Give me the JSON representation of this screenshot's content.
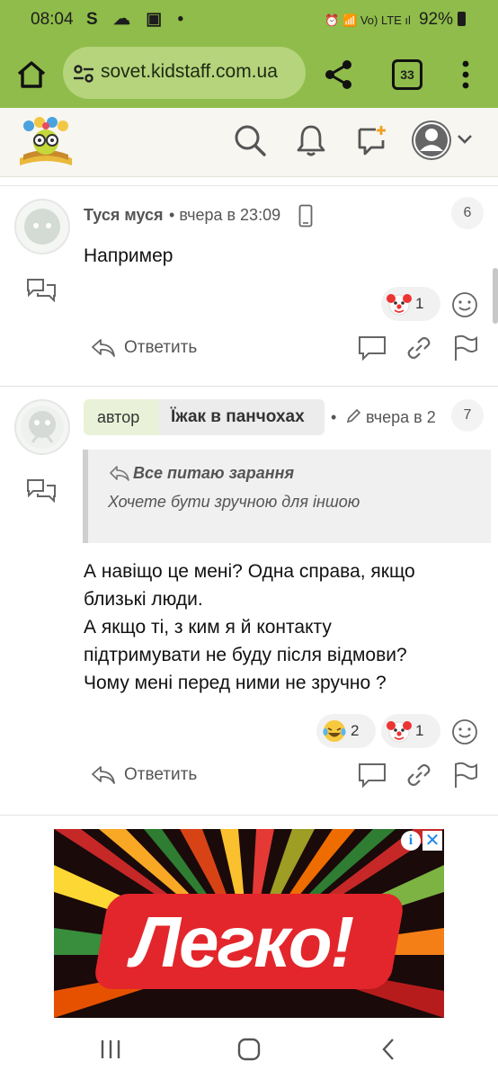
{
  "status_bar": {
    "time": "08:04",
    "left_icons": "S ☁ ▣ •",
    "right_icons": "⏰ 📶 Vo) LTE ıl",
    "battery": "92%"
  },
  "browser": {
    "url": "sovet.kidstaff.com.ua",
    "tab_count": "33"
  },
  "posts": [
    {
      "author": "Туся муся",
      "time": "вчера в 23:09",
      "number": "6",
      "content": "Например",
      "reactions": [
        {
          "icon": "clown-emoji",
          "count": "1"
        }
      ],
      "reply_label": "Ответить"
    },
    {
      "author_tag": "автор",
      "author": "Їжак в панчохах",
      "time": "вчера в 2",
      "number": "7",
      "quote": {
        "title": "Все питаю зарання",
        "text": "Хочете бути зручною для іншою"
      },
      "content_lines": [
        "А навіщо це мені? Одна справа, якщо",
        "близькі люди.",
        "А якщо ті, з ким я й контакту",
        "підтримувати не буду після відмови?",
        "Чому мені перед ними не зручно ?"
      ],
      "reactions": [
        {
          "icon": "laughing-tears-emoji",
          "count": "2"
        },
        {
          "icon": "clown-emoji",
          "count": "1"
        }
      ],
      "reply_label": "Ответить"
    }
  ],
  "ad": {
    "brand": "Легко!",
    "info": "i",
    "close": "✕"
  },
  "colors": {
    "browser_green": "#8fbc4a",
    "url_green": "#b5d47c",
    "author_tag_bg": "#e9f2d8",
    "ad_red": "#e3262b"
  }
}
